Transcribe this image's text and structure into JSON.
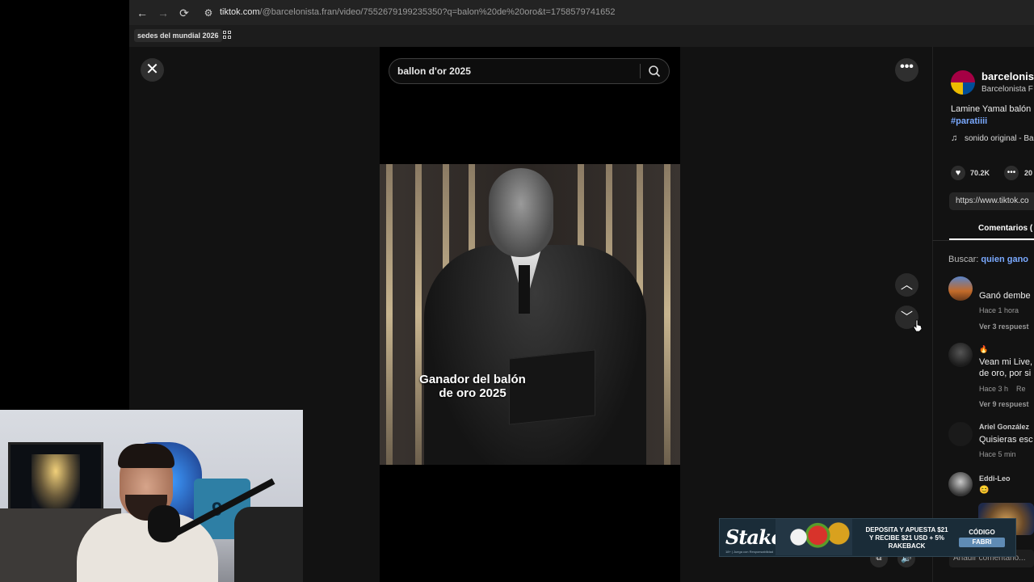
{
  "browser": {
    "url_domain": "tiktok.com",
    "url_path": "/@barcelonista.fran/video/7552679199235350?q=balon%20de%20oro&t=1758579741652",
    "bookmark": "sedes del mundial 2026",
    "icons": [
      "back-icon",
      "forward-icon",
      "reload-icon",
      "site-settings-icon",
      "apps-grid-icon"
    ]
  },
  "search": {
    "value": "ballon d'or 2025",
    "icon": "search-icon"
  },
  "video": {
    "caption_line1": "Ganador del balón",
    "caption_line2": "de oro 2025"
  },
  "controls": {
    "close": "✕",
    "more": "•••",
    "up": "︿",
    "down": "﹀"
  },
  "sidebar": {
    "user_name": "barcelonis",
    "user_sub": "Barcelonista F",
    "description": "Lamine Yamal balón",
    "hashtag": "#paratiiii",
    "music_icon": "♫",
    "music": "sonido original - Ba",
    "likes": "70.2K",
    "comments_count": "20",
    "link": "https://www.tiktok.co",
    "tab_comments": "Comentarios (",
    "search_label": "Buscar:",
    "search_query": "quien gano"
  },
  "comments": [
    {
      "name": "",
      "emoji": "",
      "text": "Ganó dembe",
      "time": "Hace 1 hora",
      "reply": "",
      "more": "Ver 3 respuest"
    },
    {
      "name": "",
      "emoji": "🔥",
      "text_line1": "Vean mi Live,",
      "text_line2": "de oro, por si",
      "time": "Hace 3 h",
      "reply": "Re",
      "more": "Ver 9 respuest"
    },
    {
      "name": "Ariel González",
      "text": "Quisieras esc",
      "time": "Hace 5 min"
    },
    {
      "name": "Eddi-Leo",
      "emoji": "😊"
    }
  ],
  "footer": {
    "add_comment": "Añadir comentario...",
    "pip": "⧉",
    "volume": "🔊"
  },
  "banner": {
    "logo": "Stake",
    "logo_sub": "18+ | Juega con Responsabilidad",
    "line1": "DEPOSITA Y APUESTA $21",
    "line2": "Y RECIBE $21 USD + 5%",
    "line3": "RAKEBACK",
    "code_label": "CÓDIGO",
    "code": "FABRI"
  },
  "webcam": {
    "jersey_number": "9"
  },
  "colors": {
    "accent_link": "#7aa9ff",
    "page_bg": "#121212",
    "banner_bg": "#1a2c38",
    "code_bg": "#5f8bb4"
  }
}
